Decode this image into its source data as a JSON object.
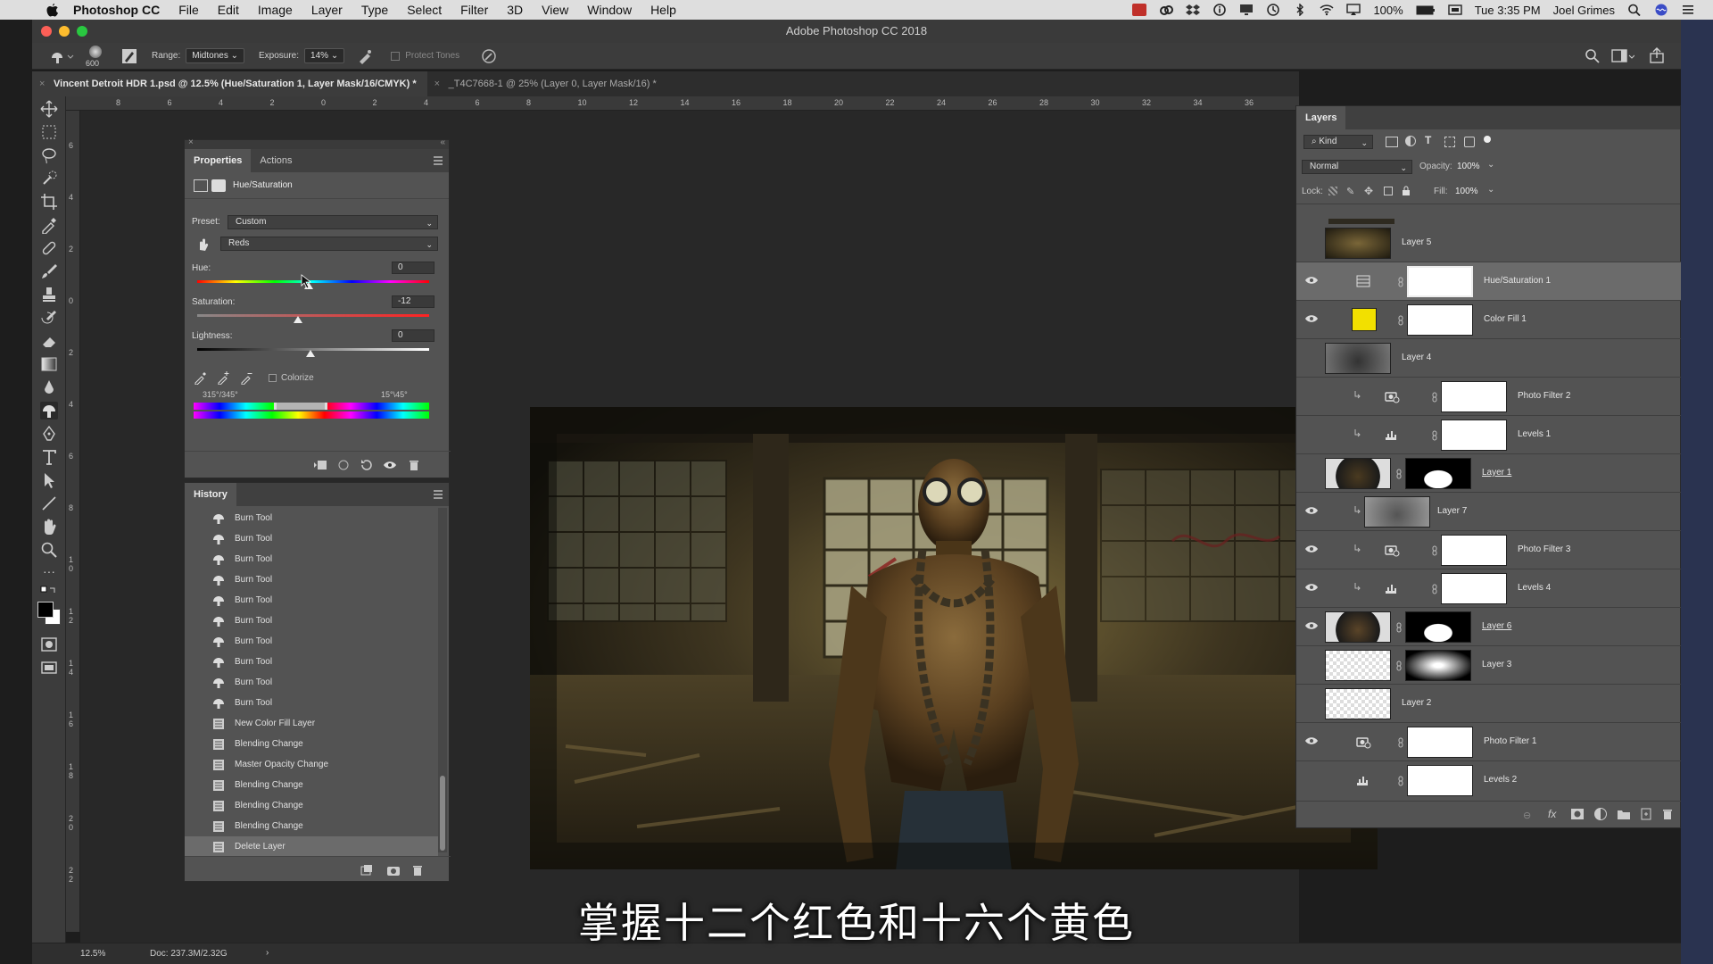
{
  "menubar": {
    "app": "Photoshop CC",
    "items": [
      "File",
      "Edit",
      "Image",
      "Layer",
      "Type",
      "Select",
      "Filter",
      "3D",
      "View",
      "Window",
      "Help"
    ],
    "battery": "100%",
    "clock": "Tue 3:35 PM",
    "user": "Joel Grimes"
  },
  "window": {
    "title": "Adobe Photoshop CC 2018"
  },
  "options": {
    "brush_size": "600",
    "range_label": "Range:",
    "range_value": "Midtones",
    "exposure_label": "Exposure:",
    "exposure_value": "14%",
    "protect_tones": "Protect Tones"
  },
  "tabs": [
    {
      "label": "Vincent Detroit HDR 1.psd @ 12.5% (Hue/Saturation 1, Layer Mask/16/CMYK) *"
    },
    {
      "label": "_T4C7668-1 @ 25% (Layer 0, Layer Mask/16) *"
    }
  ],
  "ruler": {
    "h_labels": [
      "8",
      "6",
      "4",
      "2",
      "0",
      "2",
      "4",
      "6",
      "8",
      "10",
      "12",
      "14",
      "16",
      "18",
      "20",
      "22",
      "24",
      "26",
      "28",
      "30",
      "32",
      "34",
      "36"
    ],
    "v_labels": [
      "6",
      "4",
      "2",
      "0",
      "2",
      "4",
      "6",
      "8",
      "1 0",
      "1 2",
      "1 4",
      "1 6",
      "1 8",
      "2 0",
      "2 2"
    ]
  },
  "properties": {
    "tabs": [
      "Properties",
      "Actions"
    ],
    "title": "Hue/Saturation",
    "preset_label": "Preset:",
    "preset_value": "Custom",
    "channel_value": "Reds",
    "hue_label": "Hue:",
    "hue_value": "0",
    "saturation_label": "Saturation:",
    "saturation_value": "-12",
    "lightness_label": "Lightness:",
    "lightness_value": "0",
    "colorize_label": "Colorize",
    "range_left": "315°/345°",
    "range_right": "15°\\45°"
  },
  "history": {
    "title": "History",
    "items": [
      "Burn Tool",
      "Burn Tool",
      "Burn Tool",
      "Burn Tool",
      "Burn Tool",
      "Burn Tool",
      "Burn Tool",
      "Burn Tool",
      "Burn Tool",
      "Burn Tool",
      "New Color Fill Layer",
      "Blending Change",
      "Master Opacity Change",
      "Blending Change",
      "Blending Change",
      "Blending Change",
      "Delete Layer"
    ],
    "selected_index": 16
  },
  "layers": {
    "title": "Layers",
    "kind_label": "Kind",
    "blend_mode": "Normal",
    "opacity_label": "Opacity:",
    "opacity_value": "100%",
    "lock_label": "Lock:",
    "fill_label": "Fill:",
    "fill_value": "100%",
    "rows": [
      "Layer 5",
      "Hue/Saturation 1",
      "Color Fill 1",
      "Layer 4",
      "Photo Filter 2",
      "Levels 1",
      "Layer 1",
      "Layer 7",
      "Photo Filter 3",
      "Levels 4",
      "Layer 6",
      "Layer 3",
      "Layer 2",
      "Photo Filter 1",
      "Levels 2"
    ],
    "accent_yellow": "#f2e000"
  },
  "status": {
    "zoom": "12.5%",
    "doc": "Doc: 237.3M/2.32G"
  },
  "subtitle": "掌握十二个红色和十六个黄色"
}
